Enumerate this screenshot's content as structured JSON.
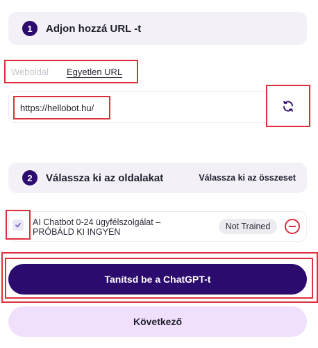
{
  "step1": {
    "number": "1",
    "title": "Adjon hozzá URL -t"
  },
  "tabs": [
    {
      "label": "Weboldal",
      "active": false
    },
    {
      "label": "Egyetlen URL",
      "active": true
    }
  ],
  "url_input": {
    "value": "https://hellobot.hu/"
  },
  "icons": {
    "refresh": "refresh-icon",
    "check": "check-icon",
    "remove": "minus-circle-icon"
  },
  "step2": {
    "number": "2",
    "title": "Válassza ki az oldalakat",
    "select_all": "Válassza ki az összeset"
  },
  "pages": [
    {
      "title": "AI Chatbot 0-24 ügyfélszolgálat – PRÓBÁLD KI INGYEN",
      "status": "Not Trained",
      "checked": true
    }
  ],
  "buttons": {
    "train": "Tanítsd be a ChatGPT-t",
    "next": "Következő"
  },
  "colors": {
    "primary": "#2b0b6e",
    "secondary_button": "#f1e0fb",
    "highlight": "#e02f3b",
    "danger": "#d92b3a"
  }
}
